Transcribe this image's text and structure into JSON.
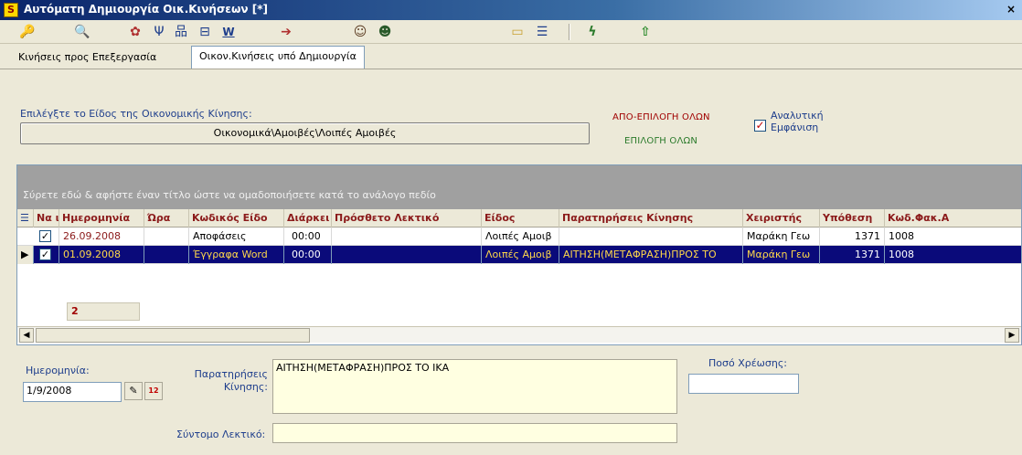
{
  "window": {
    "app_badge": "S",
    "title": "Αυτόματη Δημιουργία Οικ.Κινήσεων [*]",
    "close_glyph": "×"
  },
  "toolbar": {
    "icons": [
      "key-icon",
      "search-icon",
      "palette-icon",
      "tree-icon",
      "hierarchy-icon",
      "list-icon",
      "word-icon",
      "export-icon",
      "user-icon",
      "users-icon",
      "folder-icon",
      "checklist-icon",
      "lightning-icon",
      "arrow-up-icon"
    ],
    "glyphs": [
      "🔑",
      "🔍",
      "✿",
      "Ψ",
      "品",
      "⊟",
      "W",
      "➔",
      "☺",
      "☻",
      "▭",
      "☰",
      "ϟ",
      "⇧"
    ]
  },
  "tabs": [
    {
      "label": "Κινήσεις προς Επεξεργασία",
      "active": false
    },
    {
      "label": "Οικον.Κινήσεις υπό Δημιουργία",
      "active": true
    }
  ],
  "selection": {
    "prompt": "Επιλέγξτε το Είδος της Οικονομικής Κίνησης:",
    "value": "Οικονομικά\\Αμοιβές\\Λοιπές Αμοιβές",
    "deselect_all": "ΑΠΟ-ΕΠΙΛΟΓΗ ΟΛΩΝ",
    "select_all": "ΕΠΙΛΟΓΗ ΟΛΩΝ",
    "analytic_line1": "Αναλυτική",
    "analytic_line2": "Εμφάνιση",
    "analytic_checked": "✓"
  },
  "grid": {
    "group_hint": "Σύρετε εδώ & αφήστε έναν τίτλο ώστε να ομαδοποιήσετε κατά το ανάλογο πεδίο",
    "columns": [
      "Να ι",
      "Ημερομηνία",
      "Ώρα",
      "Κωδικός Είδο",
      "Διάρκει",
      "Πρόσθετο Λεκτικό",
      "Είδος",
      "Παρατηρήσεις Κίνησης",
      "Χειριστής",
      "Υπόθεση",
      "Κωδ.Φακ.Α"
    ],
    "rows": [
      {
        "check": "✓",
        "date": "26.09.2008",
        "time": "",
        "kod": "Αποφάσεις",
        "dur": "00:00",
        "extra": "",
        "eidos": "Λοιπές Αμοιβ",
        "notes": "",
        "user": "Μαράκη Γεω",
        "case": "1371",
        "fak": "1008",
        "selected": false
      },
      {
        "check": "✓",
        "date": "01.09.2008",
        "time": "",
        "kod": "Έγγραφα Word",
        "dur": "00:00",
        "extra": "",
        "eidos": "Λοιπές Αμοιβ",
        "notes": "ΑΙΤΗΣΗ(ΜΕΤΑΦΡΑΣΗ)ΠΡΟΣ ΤΟ",
        "user": "Μαράκη Γεω",
        "case": "1371",
        "fak": "1008",
        "selected": true
      }
    ],
    "count": "2",
    "selected_marker": "▶",
    "scroll_left": "◀",
    "scroll_right": "▶"
  },
  "form": {
    "date_label": "Ημερομηνία:",
    "date_value": "1/9/2008",
    "date_btn1": "✎",
    "date_btn2": "12",
    "notes_label_1": "Παρατηρήσεις",
    "notes_label_2": "Κίνησης:",
    "notes_value": "ΑΙΤΗΣΗ(ΜΕΤΑΦΡΑΣΗ)ΠΡΟΣ ΤΟ ΙΚΑ",
    "charge_label": "Ποσό Χρέωσης:",
    "charge_value": "",
    "short_label": "Σύντομο Λεκτικό:",
    "short_value": ""
  }
}
